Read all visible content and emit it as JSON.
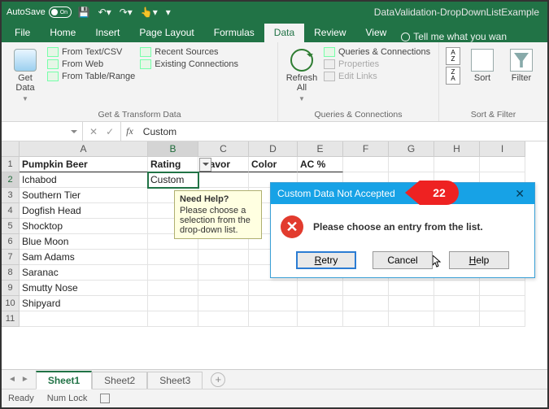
{
  "titlebar": {
    "autosave": "AutoSave",
    "toggle_state": "On",
    "doc_title": "DataValidation-DropDownListExample"
  },
  "tabs": {
    "file": "File",
    "home": "Home",
    "insert": "Insert",
    "page_layout": "Page Layout",
    "formulas": "Formulas",
    "data": "Data",
    "review": "Review",
    "view": "View",
    "tellme": "Tell me what you wan"
  },
  "ribbon": {
    "get_data": "Get\nData",
    "from_text": "From Text/CSV",
    "from_web": "From Web",
    "from_table": "From Table/Range",
    "recent": "Recent Sources",
    "existing": "Existing Connections",
    "group1_caption": "Get & Transform Data",
    "refresh": "Refresh\nAll",
    "queries": "Queries & Connections",
    "properties": "Properties",
    "editlinks": "Edit Links",
    "group2_caption": "Queries & Connections",
    "sort": "Sort",
    "filter": "Filter",
    "group3_caption": "Sort & Filter"
  },
  "formula_bar": {
    "namebox": "",
    "fx": "fx",
    "value": "Custom"
  },
  "columns": {
    "widths": [
      158,
      62,
      62,
      60,
      56,
      56,
      56,
      56,
      56
    ],
    "labels": [
      "A",
      "B",
      "C",
      "D",
      "E",
      "F",
      "G",
      "H",
      "I"
    ]
  },
  "rows": [
    "1",
    "2",
    "3",
    "4",
    "5",
    "6",
    "7",
    "8",
    "9",
    "10",
    "11"
  ],
  "selected": {
    "col": "B",
    "row": "2"
  },
  "headers": [
    "Pumpkin Beer",
    "Rating",
    "Flavor",
    "Color",
    "AC %"
  ],
  "data_rows": [
    [
      "Ichabod",
      "Custom",
      "",
      "",
      ""
    ],
    [
      "Southern Tier",
      "",
      "",
      "",
      ""
    ],
    [
      "Dogfish Head",
      "",
      "",
      "",
      ""
    ],
    [
      "Shocktop",
      "",
      "",
      "",
      ""
    ],
    [
      "Blue Moon",
      "",
      "",
      "",
      ""
    ],
    [
      "Sam Adams",
      "",
      "",
      "",
      ""
    ],
    [
      "Saranac",
      "",
      "",
      "",
      ""
    ],
    [
      "Smutty Nose",
      "",
      "",
      "",
      ""
    ],
    [
      "Shipyard",
      "",
      "",
      "",
      ""
    ],
    [
      "",
      "",
      "",
      "",
      ""
    ]
  ],
  "tooltip": {
    "title": "Need Help?",
    "body": "Please choose a selection from the drop-down list."
  },
  "dialog": {
    "title": "Custom Data Not Accepted",
    "message": "Please choose an entry from the list.",
    "retry": "Retry",
    "cancel": "Cancel",
    "help": "Help"
  },
  "callout": "22",
  "sheets": {
    "s1": "Sheet1",
    "s2": "Sheet2",
    "s3": "Sheet3"
  },
  "status": {
    "ready": "Ready",
    "numlock": "Num Lock"
  }
}
